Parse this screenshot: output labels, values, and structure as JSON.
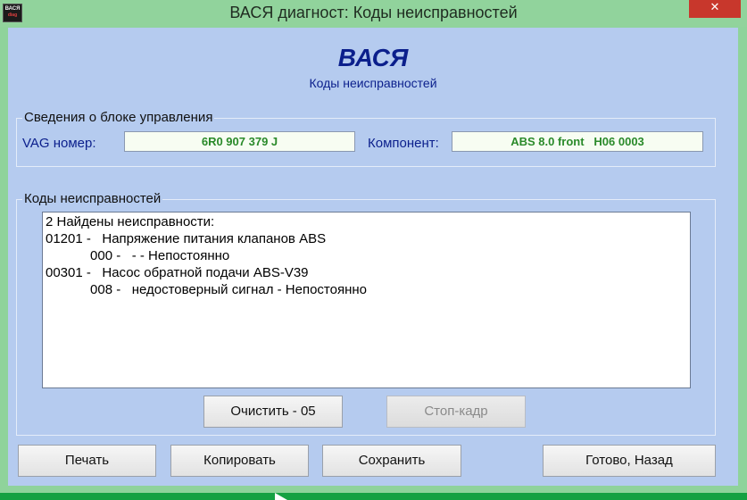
{
  "window": {
    "title": "ВАСЯ диагност: Коды неисправностей",
    "icon_text_top": "ВАСЯ",
    "icon_text_bottom": "diag",
    "close_symbol": "✕"
  },
  "header": {
    "app_name": "ВАСЯ",
    "subtitle": "Коды неисправностей"
  },
  "control_unit": {
    "legend": "Сведения о блоке управления",
    "vag_label": "VAG номер:",
    "vag_value": "6R0 907 379 J",
    "component_label": "Компонент:",
    "component_value": "ABS 8.0 front   H06 0003"
  },
  "fault_codes": {
    "legend": "Коды неисправностей",
    "lines": [
      "2 Найдены неисправности:",
      "01201 -   Напряжение питания клапанов ABS",
      "            000 -   - - Непостоянно",
      "00301 -   Насос обратной подачи ABS-V39",
      "            008 -   недостоверный сигнал - Непостоянно"
    ]
  },
  "actions": {
    "clear": "Очистить - 05",
    "freeze_frame": "Стоп-кадр"
  },
  "footer": {
    "print": "Печать",
    "copy": "Копировать",
    "save": "Сохранить",
    "done_back": "Готово, Назад"
  }
}
